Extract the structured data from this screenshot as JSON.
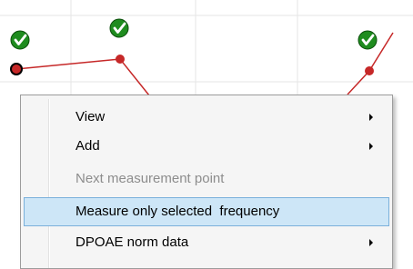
{
  "chart": {
    "grid_color": "#e6e6e6",
    "line_color": "#c62828",
    "point_fill": "#c62828",
    "check_fill": "#1f8c1f",
    "check_icon": "checkmark-icon"
  },
  "context_menu": {
    "items": [
      {
        "label": "View",
        "state": "enabled",
        "has_submenu": true
      },
      {
        "label": "Add",
        "state": "enabled",
        "has_submenu": true
      },
      {
        "label": "Next measurement point",
        "state": "disabled",
        "has_submenu": false
      },
      {
        "label": "Measure only selected  frequency",
        "state": "highlighted",
        "has_submenu": false
      },
      {
        "label": "DPOAE norm data",
        "state": "enabled",
        "has_submenu": true
      }
    ],
    "highlight_color": "#cde6f7",
    "highlight_border": "#7ab0db",
    "disabled_text_color": "#8d8d8d"
  }
}
